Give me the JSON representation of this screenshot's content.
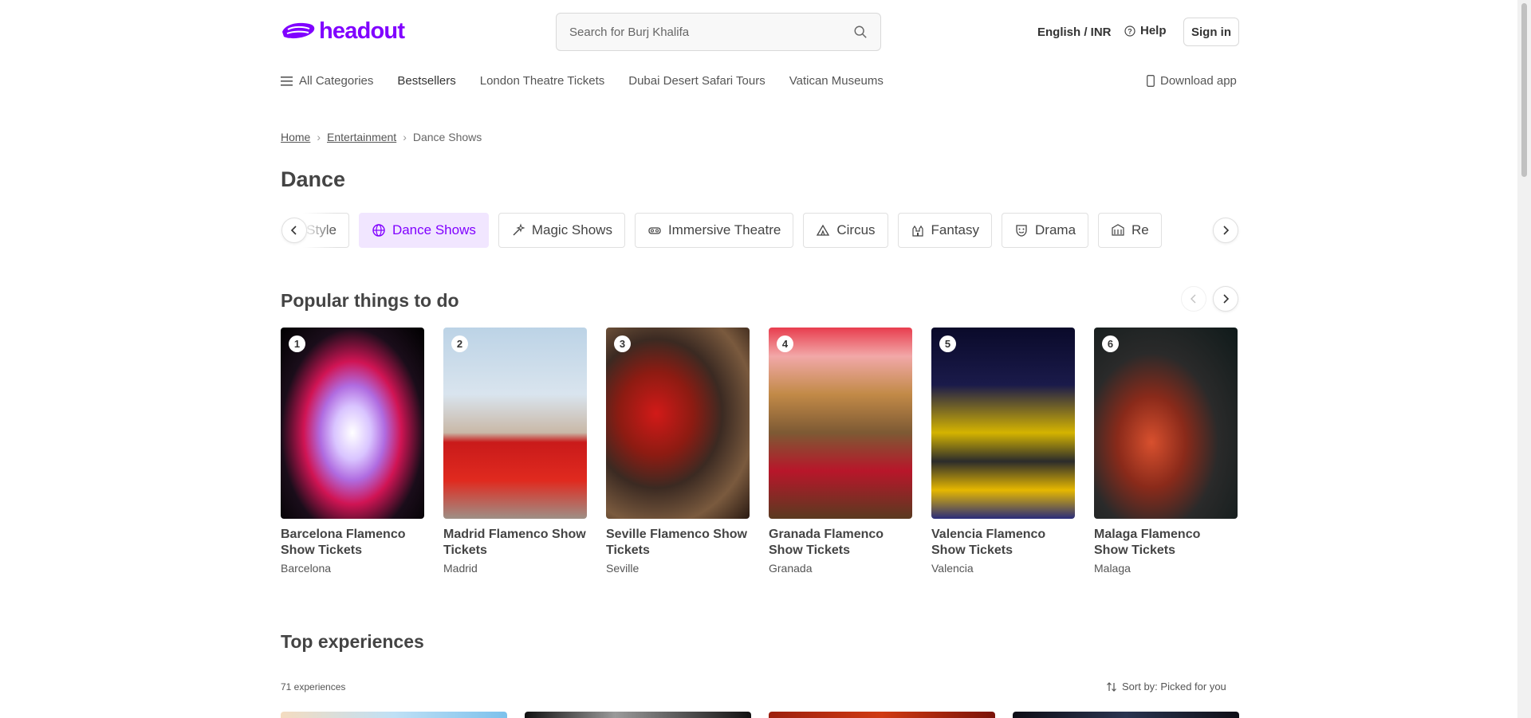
{
  "header": {
    "logo_text": "headout",
    "search_placeholder": "Search for Burj Khalifa",
    "language": "English / INR",
    "help": "Help",
    "sign_in": "Sign in",
    "brand_color": "#8000ff"
  },
  "nav": {
    "all_categories": "All Categories",
    "items": [
      "Bestsellers",
      "London Theatre Tickets",
      "Dubai Desert Safari Tours",
      "Vatican Museums"
    ],
    "download_app": "Download app"
  },
  "breadcrumb": {
    "home": "Home",
    "entertainment": "Entertainment",
    "current": "Dance Shows"
  },
  "page_title": "Dance",
  "categories": [
    {
      "label": "See it in Style",
      "icon": "none"
    },
    {
      "label": "Dance Shows",
      "icon": "globe-icon",
      "active": true
    },
    {
      "label": "Magic Shows",
      "icon": "magic-wand-icon"
    },
    {
      "label": "Immersive Theatre",
      "icon": "vr-headset-icon"
    },
    {
      "label": "Circus",
      "icon": "circus-tent-icon"
    },
    {
      "label": "Fantasy",
      "icon": "castle-icon"
    },
    {
      "label": "Drama",
      "icon": "theatre-mask-icon"
    },
    {
      "label": "Re",
      "icon": "building-icon"
    }
  ],
  "popular": {
    "title": "Popular things to do",
    "items": [
      {
        "rank": "1",
        "name": "Barcelona Flamenco Show Tickets",
        "city": "Barcelona"
      },
      {
        "rank": "2",
        "name": "Madrid Flamenco Show Tickets",
        "city": "Madrid"
      },
      {
        "rank": "3",
        "name": "Seville Flamenco Show Tickets",
        "city": "Seville"
      },
      {
        "rank": "4",
        "name": "Granada Flamenco Show Tickets",
        "city": "Granada"
      },
      {
        "rank": "5",
        "name": "Valencia Flamenco Show Tickets",
        "city": "Valencia"
      },
      {
        "rank": "6",
        "name": "Malaga Flamenco Show Tickets",
        "city": "Malaga"
      }
    ]
  },
  "top": {
    "title": "Top experiences",
    "count": "71 experiences",
    "sort": "Sort by: Picked for you"
  }
}
